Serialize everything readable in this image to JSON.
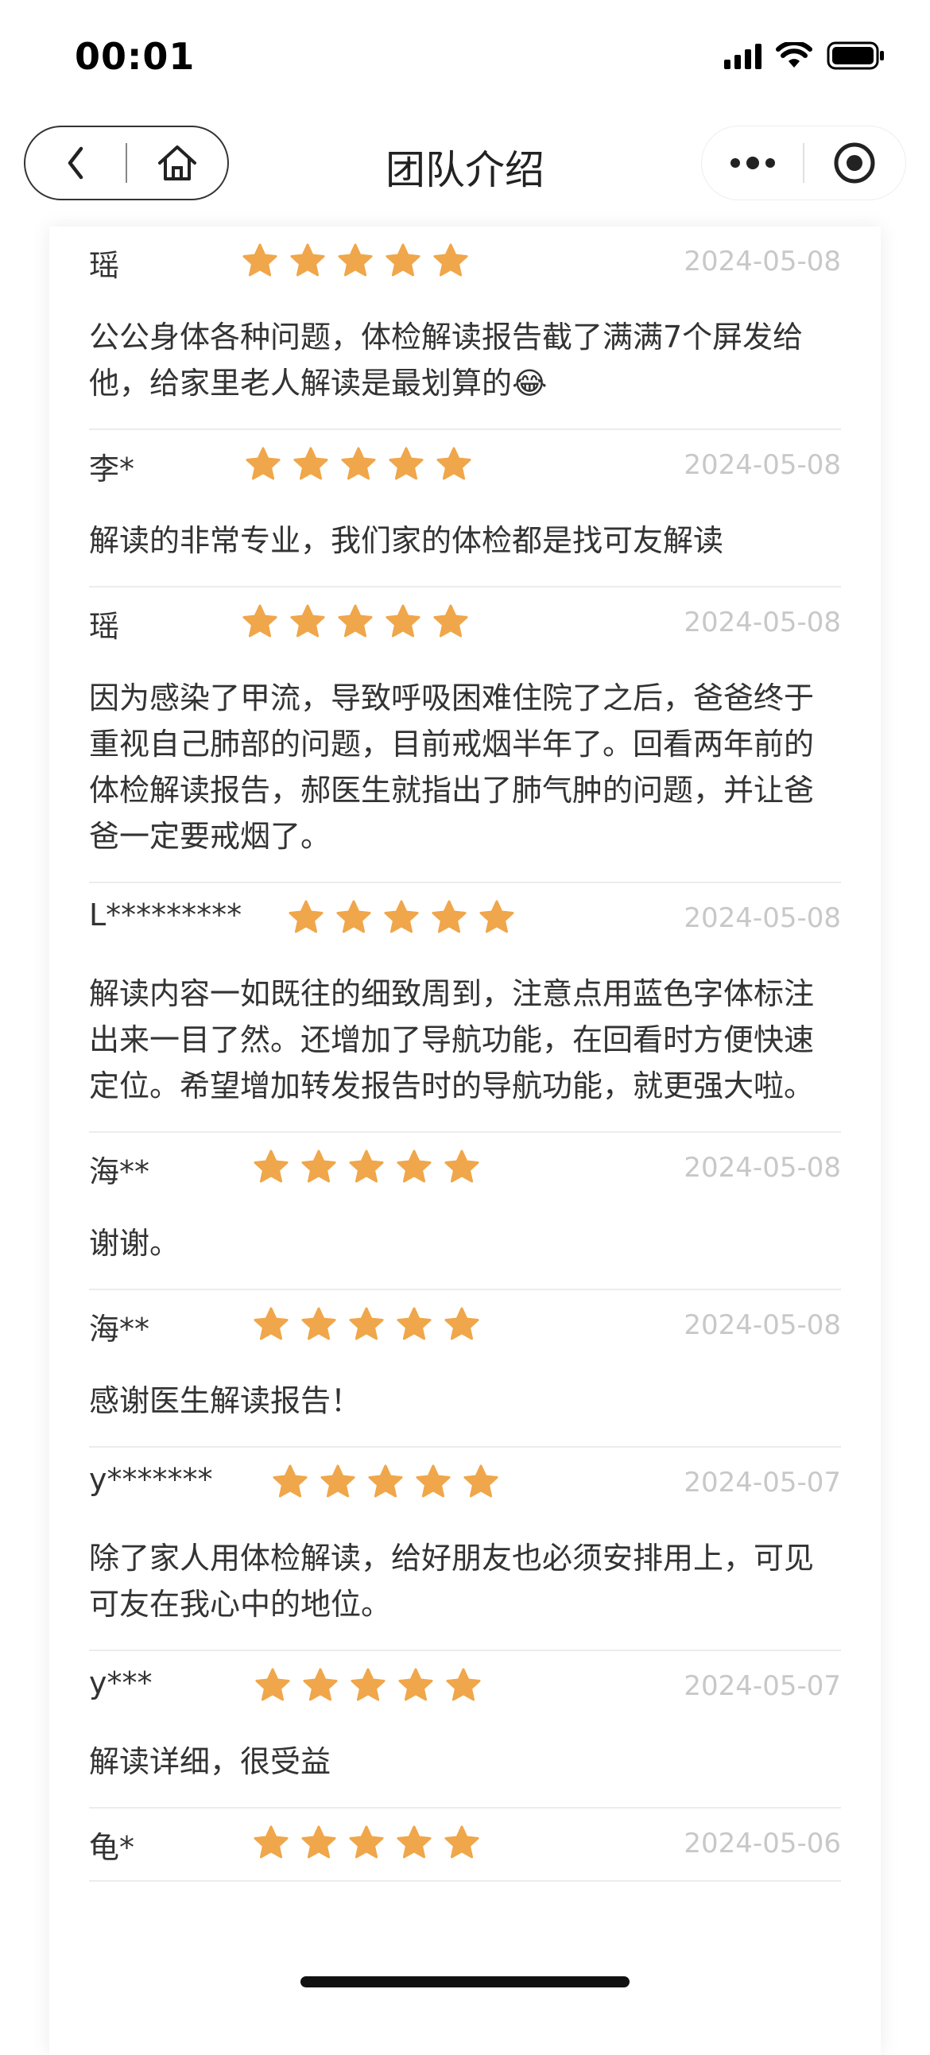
{
  "status_bar": {
    "time": "00:01"
  },
  "nav": {
    "title": "团队介绍"
  },
  "reviews": [
    {
      "name": "瑶",
      "rating": 5,
      "date": "2024-05-08",
      "text": "公公身体各种问题，体检解读报告截了满满7个屏发给他，给家里老人解读是最划算的😂"
    },
    {
      "name": "李*",
      "rating": 5,
      "date": "2024-05-08",
      "text": "解读的非常专业，我们家的体检都是找可友解读"
    },
    {
      "name": "瑶",
      "rating": 5,
      "date": "2024-05-08",
      "text": "因为感染了甲流，导致呼吸困难住院了之后，爸爸终于重视自己肺部的问题，目前戒烟半年了。回看两年前的体检解读报告，郝医生就指出了肺气肿的问题，并让爸爸一定要戒烟了。"
    },
    {
      "name": "L*********",
      "rating": 5,
      "date": "2024-05-08",
      "text": "解读内容一如既往的细致周到，注意点用蓝色字体标注出来一目了然。还增加了导航功能，在回看时方便快速定位。希望增加转发报告时的导航功能，就更强大啦。"
    },
    {
      "name": "海**",
      "rating": 5,
      "date": "2024-05-08",
      "text": "谢谢。"
    },
    {
      "name": "海**",
      "rating": 5,
      "date": "2024-05-08",
      "text": "感谢医生解读报告！"
    },
    {
      "name": "y*******",
      "rating": 5,
      "date": "2024-05-07",
      "text": "除了家人用体检解读，给好朋友也必须安排用上，可见可友在我心中的地位。"
    },
    {
      "name": "y***",
      "rating": 5,
      "date": "2024-05-07",
      "text": "解读详细，很受益"
    },
    {
      "name": "龟*",
      "rating": 5,
      "date": "2024-05-06",
      "text": ""
    }
  ],
  "colors": {
    "star": "#F0A64A",
    "date": "#C8C8C8",
    "divider": "#ECECEC"
  }
}
